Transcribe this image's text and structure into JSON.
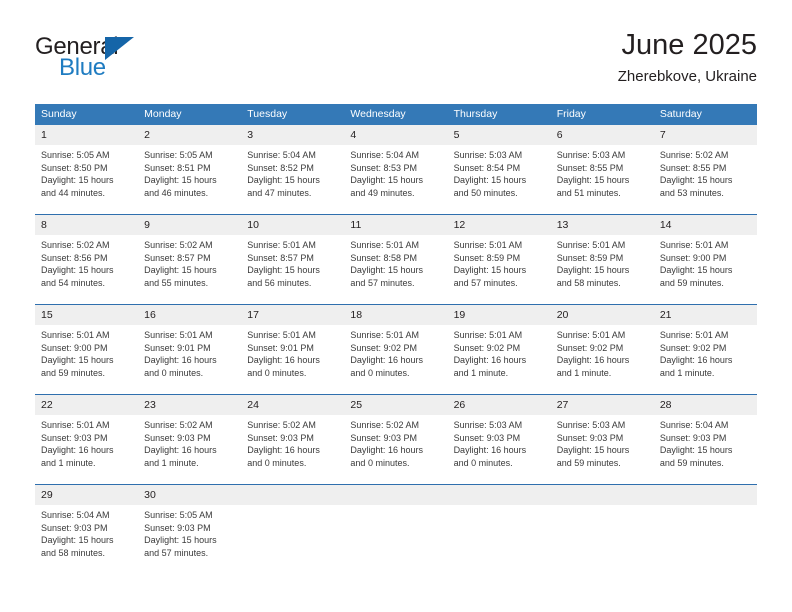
{
  "brand": {
    "name_top": "General",
    "name_bottom": "Blue",
    "accent_color": "#1565a8",
    "blue_text_color": "#1f7cc1",
    "triangle_icon": "triangle-flag-icon"
  },
  "header": {
    "title": "June 2025",
    "subtitle": "Zherebkove, Ukraine"
  },
  "theme": {
    "header_row_bg": "#3479b7",
    "daynum_bg": "#efefef",
    "row_divider": "#2f6fae",
    "text": "#231f20"
  },
  "calendar": {
    "weekday_headers": [
      "Sunday",
      "Monday",
      "Tuesday",
      "Wednesday",
      "Thursday",
      "Friday",
      "Saturday"
    ],
    "weeks": [
      [
        {
          "day": "1",
          "sunrise": "Sunrise: 5:05 AM",
          "sunset": "Sunset: 8:50 PM",
          "daylight_line1": "Daylight: 15 hours",
          "daylight_line2": "and 44 minutes."
        },
        {
          "day": "2",
          "sunrise": "Sunrise: 5:05 AM",
          "sunset": "Sunset: 8:51 PM",
          "daylight_line1": "Daylight: 15 hours",
          "daylight_line2": "and 46 minutes."
        },
        {
          "day": "3",
          "sunrise": "Sunrise: 5:04 AM",
          "sunset": "Sunset: 8:52 PM",
          "daylight_line1": "Daylight: 15 hours",
          "daylight_line2": "and 47 minutes."
        },
        {
          "day": "4",
          "sunrise": "Sunrise: 5:04 AM",
          "sunset": "Sunset: 8:53 PM",
          "daylight_line1": "Daylight: 15 hours",
          "daylight_line2": "and 49 minutes."
        },
        {
          "day": "5",
          "sunrise": "Sunrise: 5:03 AM",
          "sunset": "Sunset: 8:54 PM",
          "daylight_line1": "Daylight: 15 hours",
          "daylight_line2": "and 50 minutes."
        },
        {
          "day": "6",
          "sunrise": "Sunrise: 5:03 AM",
          "sunset": "Sunset: 8:55 PM",
          "daylight_line1": "Daylight: 15 hours",
          "daylight_line2": "and 51 minutes."
        },
        {
          "day": "7",
          "sunrise": "Sunrise: 5:02 AM",
          "sunset": "Sunset: 8:55 PM",
          "daylight_line1": "Daylight: 15 hours",
          "daylight_line2": "and 53 minutes."
        }
      ],
      [
        {
          "day": "8",
          "sunrise": "Sunrise: 5:02 AM",
          "sunset": "Sunset: 8:56 PM",
          "daylight_line1": "Daylight: 15 hours",
          "daylight_line2": "and 54 minutes."
        },
        {
          "day": "9",
          "sunrise": "Sunrise: 5:02 AM",
          "sunset": "Sunset: 8:57 PM",
          "daylight_line1": "Daylight: 15 hours",
          "daylight_line2": "and 55 minutes."
        },
        {
          "day": "10",
          "sunrise": "Sunrise: 5:01 AM",
          "sunset": "Sunset: 8:57 PM",
          "daylight_line1": "Daylight: 15 hours",
          "daylight_line2": "and 56 minutes."
        },
        {
          "day": "11",
          "sunrise": "Sunrise: 5:01 AM",
          "sunset": "Sunset: 8:58 PM",
          "daylight_line1": "Daylight: 15 hours",
          "daylight_line2": "and 57 minutes."
        },
        {
          "day": "12",
          "sunrise": "Sunrise: 5:01 AM",
          "sunset": "Sunset: 8:59 PM",
          "daylight_line1": "Daylight: 15 hours",
          "daylight_line2": "and 57 minutes."
        },
        {
          "day": "13",
          "sunrise": "Sunrise: 5:01 AM",
          "sunset": "Sunset: 8:59 PM",
          "daylight_line1": "Daylight: 15 hours",
          "daylight_line2": "and 58 minutes."
        },
        {
          "day": "14",
          "sunrise": "Sunrise: 5:01 AM",
          "sunset": "Sunset: 9:00 PM",
          "daylight_line1": "Daylight: 15 hours",
          "daylight_line2": "and 59 minutes."
        }
      ],
      [
        {
          "day": "15",
          "sunrise": "Sunrise: 5:01 AM",
          "sunset": "Sunset: 9:00 PM",
          "daylight_line1": "Daylight: 15 hours",
          "daylight_line2": "and 59 minutes."
        },
        {
          "day": "16",
          "sunrise": "Sunrise: 5:01 AM",
          "sunset": "Sunset: 9:01 PM",
          "daylight_line1": "Daylight: 16 hours",
          "daylight_line2": "and 0 minutes."
        },
        {
          "day": "17",
          "sunrise": "Sunrise: 5:01 AM",
          "sunset": "Sunset: 9:01 PM",
          "daylight_line1": "Daylight: 16 hours",
          "daylight_line2": "and 0 minutes."
        },
        {
          "day": "18",
          "sunrise": "Sunrise: 5:01 AM",
          "sunset": "Sunset: 9:02 PM",
          "daylight_line1": "Daylight: 16 hours",
          "daylight_line2": "and 0 minutes."
        },
        {
          "day": "19",
          "sunrise": "Sunrise: 5:01 AM",
          "sunset": "Sunset: 9:02 PM",
          "daylight_line1": "Daylight: 16 hours",
          "daylight_line2": "and 1 minute."
        },
        {
          "day": "20",
          "sunrise": "Sunrise: 5:01 AM",
          "sunset": "Sunset: 9:02 PM",
          "daylight_line1": "Daylight: 16 hours",
          "daylight_line2": "and 1 minute."
        },
        {
          "day": "21",
          "sunrise": "Sunrise: 5:01 AM",
          "sunset": "Sunset: 9:02 PM",
          "daylight_line1": "Daylight: 16 hours",
          "daylight_line2": "and 1 minute."
        }
      ],
      [
        {
          "day": "22",
          "sunrise": "Sunrise: 5:01 AM",
          "sunset": "Sunset: 9:03 PM",
          "daylight_line1": "Daylight: 16 hours",
          "daylight_line2": "and 1 minute."
        },
        {
          "day": "23",
          "sunrise": "Sunrise: 5:02 AM",
          "sunset": "Sunset: 9:03 PM",
          "daylight_line1": "Daylight: 16 hours",
          "daylight_line2": "and 1 minute."
        },
        {
          "day": "24",
          "sunrise": "Sunrise: 5:02 AM",
          "sunset": "Sunset: 9:03 PM",
          "daylight_line1": "Daylight: 16 hours",
          "daylight_line2": "and 0 minutes."
        },
        {
          "day": "25",
          "sunrise": "Sunrise: 5:02 AM",
          "sunset": "Sunset: 9:03 PM",
          "daylight_line1": "Daylight: 16 hours",
          "daylight_line2": "and 0 minutes."
        },
        {
          "day": "26",
          "sunrise": "Sunrise: 5:03 AM",
          "sunset": "Sunset: 9:03 PM",
          "daylight_line1": "Daylight: 16 hours",
          "daylight_line2": "and 0 minutes."
        },
        {
          "day": "27",
          "sunrise": "Sunrise: 5:03 AM",
          "sunset": "Sunset: 9:03 PM",
          "daylight_line1": "Daylight: 15 hours",
          "daylight_line2": "and 59 minutes."
        },
        {
          "day": "28",
          "sunrise": "Sunrise: 5:04 AM",
          "sunset": "Sunset: 9:03 PM",
          "daylight_line1": "Daylight: 15 hours",
          "daylight_line2": "and 59 minutes."
        }
      ],
      [
        {
          "day": "29",
          "sunrise": "Sunrise: 5:04 AM",
          "sunset": "Sunset: 9:03 PM",
          "daylight_line1": "Daylight: 15 hours",
          "daylight_line2": "and 58 minutes."
        },
        {
          "day": "30",
          "sunrise": "Sunrise: 5:05 AM",
          "sunset": "Sunset: 9:03 PM",
          "daylight_line1": "Daylight: 15 hours",
          "daylight_line2": "and 57 minutes."
        },
        {
          "day": "",
          "sunrise": "",
          "sunset": "",
          "daylight_line1": "",
          "daylight_line2": ""
        },
        {
          "day": "",
          "sunrise": "",
          "sunset": "",
          "daylight_line1": "",
          "daylight_line2": ""
        },
        {
          "day": "",
          "sunrise": "",
          "sunset": "",
          "daylight_line1": "",
          "daylight_line2": ""
        },
        {
          "day": "",
          "sunrise": "",
          "sunset": "",
          "daylight_line1": "",
          "daylight_line2": ""
        },
        {
          "day": "",
          "sunrise": "",
          "sunset": "",
          "daylight_line1": "",
          "daylight_line2": ""
        }
      ]
    ]
  }
}
